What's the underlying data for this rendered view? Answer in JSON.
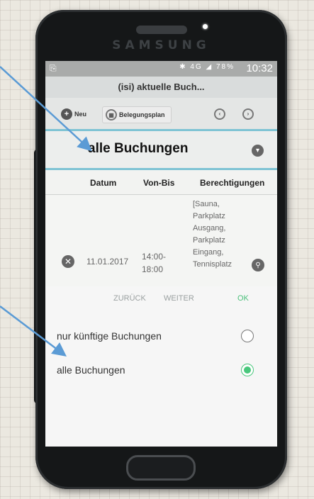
{
  "device": {
    "brand": "SAMSUNG"
  },
  "statusbar": {
    "left_icon": "⎘",
    "icons": "✱ 4G ◢ 78%",
    "time": "10:32"
  },
  "app": {
    "title": "(isi) aktuelle Buch..."
  },
  "toolbar": {
    "new_label": "Neu",
    "plan_label": "Belegungsplan",
    "prev_icon": "prev-circle-icon",
    "next_icon": "next-circle-icon"
  },
  "filter": {
    "selected": "alle Buchungen"
  },
  "table": {
    "headers": [
      "Datum",
      "Von-Bis",
      "Berechtigungen"
    ],
    "row": {
      "date": "11.01.2017",
      "time_from": "14:00-",
      "time_to": "18:00",
      "permissions": [
        "[Sauna,",
        "Parkplatz",
        "Ausgang,",
        "Parkplatz",
        "Eingang,",
        "Tennisplatz"
      ]
    }
  },
  "dialog": {
    "back_label": "ZURÜCK",
    "next_label": "WEITER",
    "ok_label": "OK",
    "options": [
      {
        "label": "nur künftige Buchungen",
        "selected": false
      },
      {
        "label": "alle Buchungen",
        "selected": true
      }
    ]
  },
  "colors": {
    "accent": "#7ec3d4",
    "ok": "#4bbf7a",
    "annotation_arrow": "#5b9bd5"
  }
}
